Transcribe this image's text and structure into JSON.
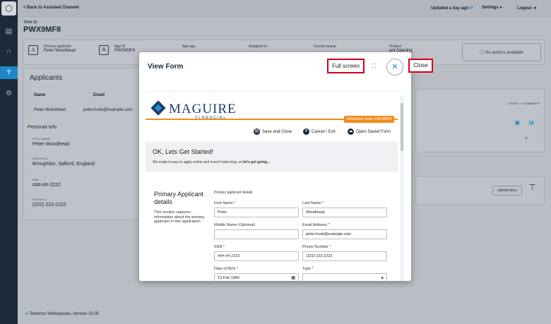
{
  "topbar": {
    "back_label": "< Back to Assisted Channel",
    "updated": "Updated a day ago",
    "settings": "Settings",
    "logout": "Logout"
  },
  "task": {
    "label": "TASK ID",
    "id": "PWX9MF8"
  },
  "strip": {
    "primary_applicant_label": "Primary applicant",
    "primary_applicant_value": "Peter Woodhead",
    "app_id_label": "App ID",
    "app_id_value": "PWX9MF8",
    "app_age_label": "App age",
    "assigned_label": "Assigned to",
    "current_queue_label": "Current queue",
    "product_label": "Product",
    "product_value": "ant Opening",
    "no_actions": "No actions available"
  },
  "applicants": {
    "title": "Applicants",
    "col_name": "Name",
    "col_email": "Email",
    "row_name": "Peter Woodhead",
    "row_email": "peter.hook@example.com",
    "personal_info": "Personal Info",
    "full_name_label": "FULL NAME",
    "full_name": "Peter Woodhead",
    "address_label": "ADDRESS",
    "address": "Broughton, Salford, England",
    "ssn_label": "SSN",
    "ssn": "###-##-2222",
    "phone_label": "PHONE #",
    "phone": "(222) 222-2222"
  },
  "right": {
    "tasks": "1 TASKS · 0 COMMENTS",
    "upload": "Upload docs"
  },
  "footer": "Temenos Workspaces, Version 20.05",
  "modal": {
    "title": "View Form",
    "fullscreen": "Full screen",
    "close_callout": "Close",
    "brand_name": "MAGUIRE",
    "brand_sub": "FINANCIAL",
    "ref_code": "Reference Code: PWX9MF8",
    "save_close": "Save and Close",
    "cancel_exit": "Cancel / Exit",
    "open_saved": "Open Saved Form",
    "getstart_title": "OK, Lets Get Started!",
    "getstart_sub": "We make it easy to apply online and it won't take long, so ",
    "getstart_bold": "let's get going...",
    "section_title": "Primary Applicant details",
    "section_desc": "This section captures information about the primary applicant in this application",
    "pad_heading": "Primary applicant details",
    "fields": {
      "first_name_label": "First Name",
      "first_name": "Peter",
      "last_name_label": "Last Name",
      "last_name": "Woodhead",
      "middle_name_label": "Middle Name (Optional)",
      "middle_name": "",
      "email_label": "Email Address",
      "email": "peter.hook@example.com",
      "ssn_label": "SSN",
      "ssn": "###-##-2222",
      "phone_label": "Phone Number",
      "phone": "(222) 222-2222",
      "dob_label": "Date of Birth",
      "dob": "13 Feb 1956",
      "type_label": "Type",
      "type": ""
    },
    "req_mark": "*"
  },
  "colors": {
    "accent": "#1e86c8",
    "brand_orange": "#f28c1c",
    "callout_red": "#d0021b"
  }
}
